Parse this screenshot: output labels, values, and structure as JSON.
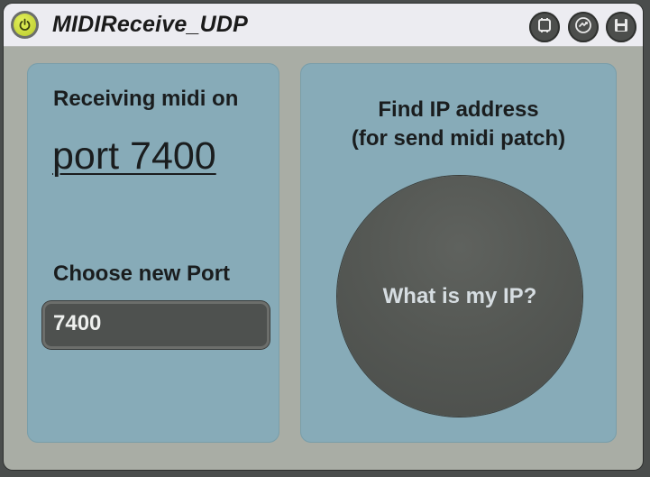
{
  "window": {
    "title": "MIDIReceive_UDP",
    "accent": "#c8d83a"
  },
  "titlebar": {
    "buttons": [
      {
        "icon": "freeze-icon"
      },
      {
        "icon": "refresh-icon"
      },
      {
        "icon": "save-icon"
      }
    ]
  },
  "left_panel": {
    "receiving_label": "Receiving midi on",
    "port_text": "port 7400",
    "choose_label": "Choose new Port",
    "port_value": "7400"
  },
  "right_panel": {
    "find_label_line1": "Find IP address",
    "find_label_line2": "(for send midi patch)",
    "ip_button_label": "What is my IP?"
  }
}
